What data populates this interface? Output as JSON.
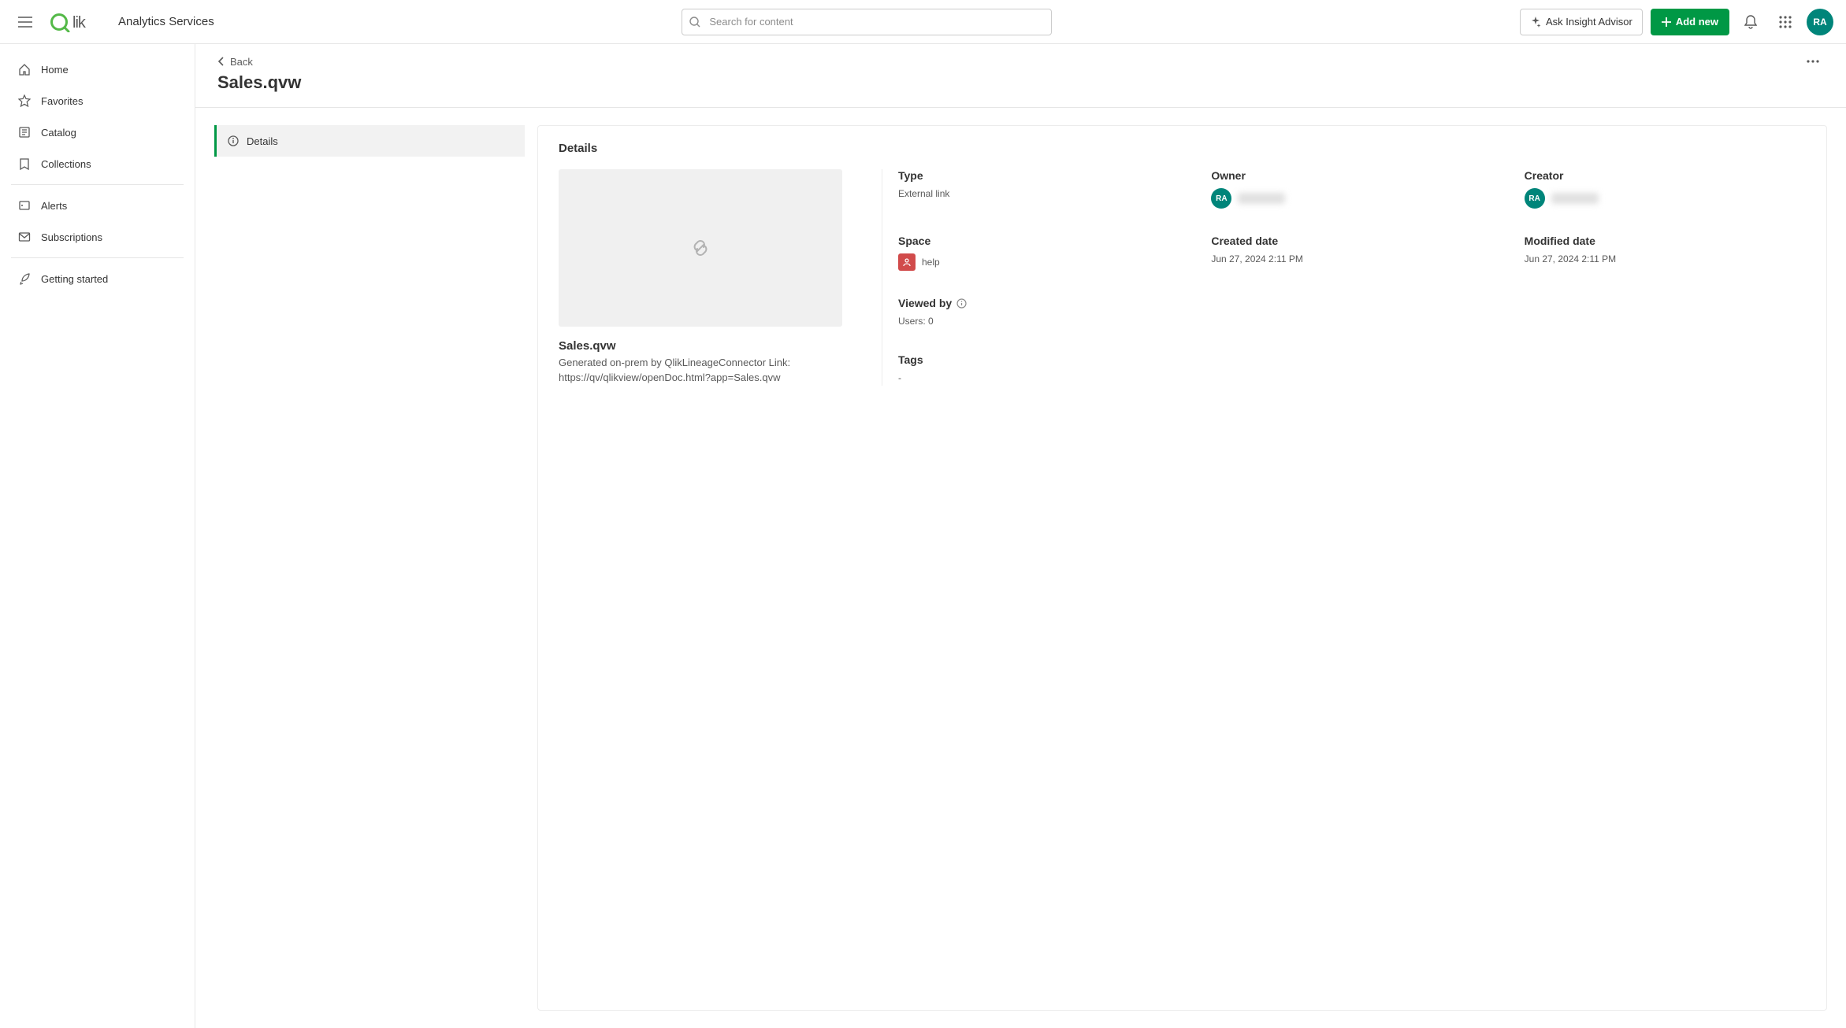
{
  "header": {
    "product_name": "Analytics Services",
    "search_placeholder": "Search for content",
    "insight_label": "Ask Insight Advisor",
    "addnew_label": "Add new",
    "avatar_initials": "RA"
  },
  "sidebar": {
    "items": [
      {
        "label": "Home",
        "icon": "home"
      },
      {
        "label": "Favorites",
        "icon": "star"
      },
      {
        "label": "Catalog",
        "icon": "catalog"
      },
      {
        "label": "Collections",
        "icon": "collections"
      }
    ],
    "items2": [
      {
        "label": "Alerts",
        "icon": "alerts"
      },
      {
        "label": "Subscriptions",
        "icon": "mail"
      }
    ],
    "items3": [
      {
        "label": "Getting started",
        "icon": "rocket"
      }
    ]
  },
  "page": {
    "back_label": "Back",
    "title": "Sales.qvw"
  },
  "tabs": {
    "details_label": "Details"
  },
  "details": {
    "panel_title": "Details",
    "item_title": "Sales.qvw",
    "item_desc": "Generated on-prem by QlikLineageConnector Link: https://qv/qlikview/openDoc.html?app=Sales.qvw",
    "type_label": "Type",
    "type_value": "External link",
    "owner_label": "Owner",
    "owner_initials": "RA",
    "creator_label": "Creator",
    "creator_initials": "RA",
    "space_label": "Space",
    "space_value": "help",
    "created_label": "Created date",
    "created_value": "Jun 27, 2024 2:11 PM",
    "modified_label": "Modified date",
    "modified_value": "Jun 27, 2024 2:11 PM",
    "viewedby_label": "Viewed by",
    "viewedby_value": "Users: 0",
    "tags_label": "Tags",
    "tags_value": "-"
  }
}
